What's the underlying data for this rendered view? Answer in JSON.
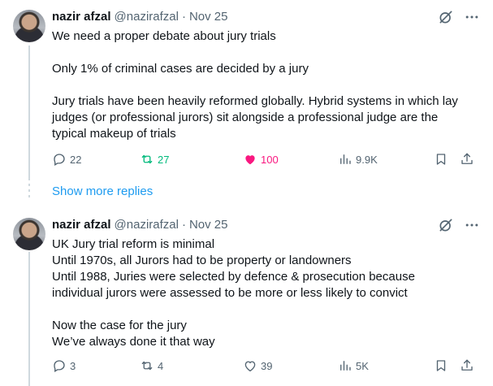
{
  "tweets": [
    {
      "display_name": "nazir afzal",
      "handle": "@nazirafzal",
      "separator": "·",
      "time": "Nov 25",
      "lines": [
        "We need a proper debate about jury trials",
        "",
        "Only 1% of criminal cases are decided by a jury",
        "",
        "Jury trials have been heavily reformed globally. Hybrid systems in which lay",
        "judges (or professional jurors) sit alongside a professional judge are the",
        "typical makeup of trials"
      ],
      "replies": "22",
      "reposts": "27",
      "likes": "100",
      "views": "9.9K",
      "liked": true,
      "reposted": true
    },
    {
      "display_name": "nazir afzal",
      "handle": "@nazirafzal",
      "separator": "·",
      "time": "Nov 25",
      "lines": [
        "UK Jury trial reform is minimal",
        "Until 1970s, all Jurors had to be property or landowners",
        "Until 1988, Juries were selected by defence & prosecution because",
        "individual jurors were assessed to be more or less likely to convict",
        "",
        "Now the case for the jury",
        "We’ve always done it that way"
      ],
      "replies": "3",
      "reposts": "4",
      "likes": "39",
      "views": "5K",
      "liked": false,
      "reposted": false
    }
  ],
  "show_more_replies": "Show more replies",
  "icons": {
    "grok": "grok-icon",
    "more": "more-icon",
    "reply": "reply-icon",
    "repost": "repost-icon",
    "like": "heart-icon",
    "views": "views-icon",
    "bookmark": "bookmark-icon",
    "share": "share-icon"
  },
  "colors": {
    "text": "#0f1419",
    "muted": "#536471",
    "link": "#1d9bf0",
    "like": "#f91880",
    "repost": "#00ba7c"
  }
}
